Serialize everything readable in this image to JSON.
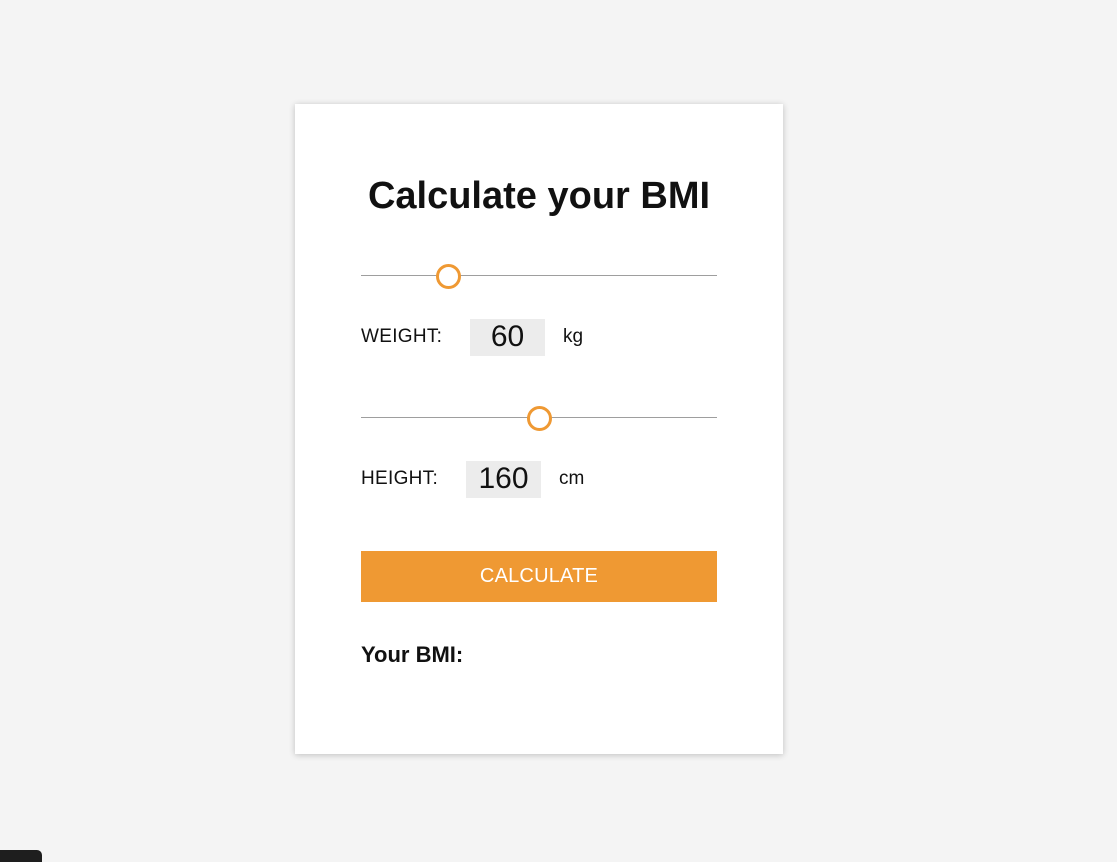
{
  "title": "Calculate your BMI",
  "weight": {
    "label": "WEIGHT:",
    "value": "60",
    "unit": "kg",
    "slider_fraction": 0.245
  },
  "height": {
    "label": "HEIGHT:",
    "value": "160",
    "unit": "cm",
    "slider_fraction": 0.5
  },
  "calculate_label": "CALCULATE",
  "result_label": "Your BMI:",
  "colors": {
    "accent": "#ef9933",
    "background": "#f4f4f4",
    "card": "#ffffff",
    "value_box": "#ececec"
  }
}
